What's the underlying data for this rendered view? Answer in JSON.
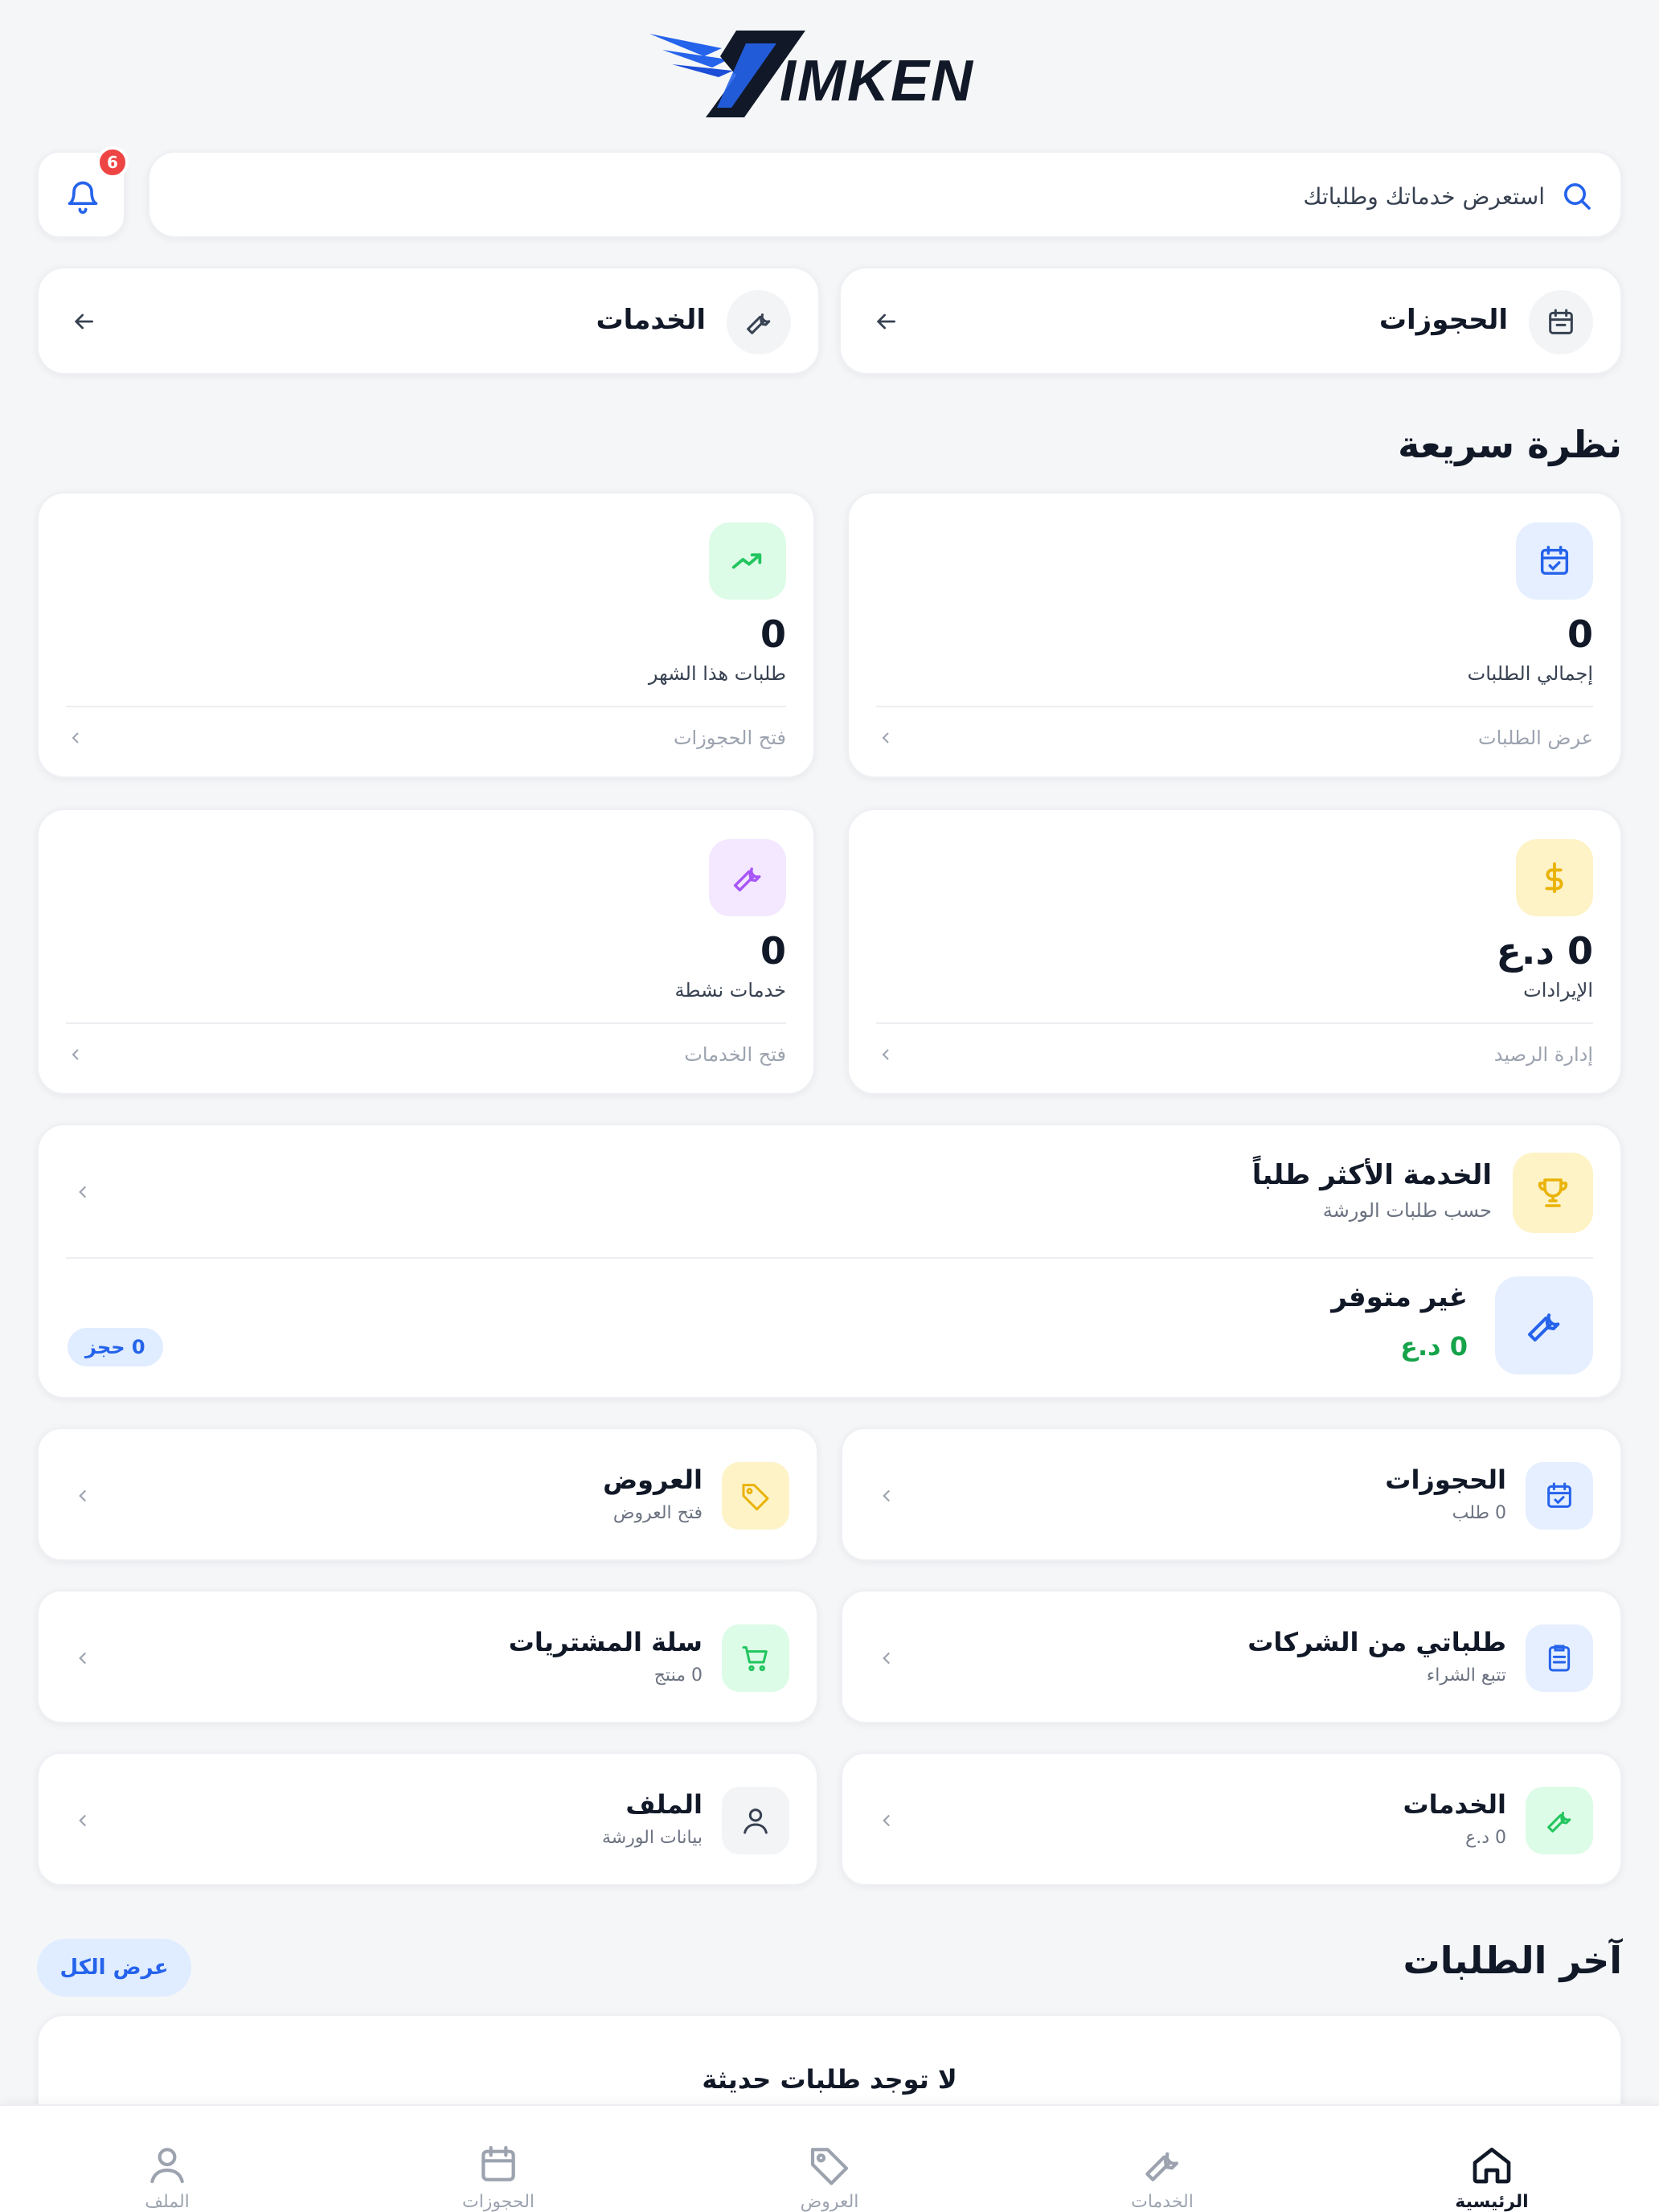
{
  "brand": {
    "logo_text": "IMKEN"
  },
  "header": {
    "search_placeholder": "استعرض خدماتك وطلباتك",
    "notification_count": "6"
  },
  "shortcuts": [
    {
      "label": "الحجوزات",
      "icon": "calendar-icon"
    },
    {
      "label": "الخدمات",
      "icon": "wrench-icon"
    }
  ],
  "overview": {
    "title": "نظرة سريعة",
    "stats": [
      {
        "value": "0",
        "label": "إجمالي الطلبات",
        "link": "عرض الطلبات",
        "icon": "calendar-check-icon",
        "color": "#2563eb"
      },
      {
        "value": "0",
        "label": "طلبات هذا الشهر",
        "link": "فتح الحجوزات",
        "icon": "trending-up-icon",
        "color": "#22c55e"
      },
      {
        "value": "0 د.ع",
        "label": "الإيرادات",
        "link": "إدارة الرصيد",
        "icon": "dollar-icon",
        "color": "#eab308"
      },
      {
        "value": "0",
        "label": "خدمات نشطة",
        "link": "فتح الخدمات",
        "icon": "wrench-icon",
        "color": "#a855f7"
      }
    ]
  },
  "top_service": {
    "title": "الخدمة الأكثر طلباً",
    "subtitle": "حسب طلبات الورشة",
    "name": "غير متوفر",
    "price": "0 د.ع",
    "badge": "0 حجز"
  },
  "quick_links": [
    {
      "title": "الحجوزات",
      "subtitle": "0 طلب",
      "icon": "calendar-check-icon"
    },
    {
      "title": "العروض",
      "subtitle": "فتح العروض",
      "icon": "tag-icon"
    },
    {
      "title": "طلباتي من الشركات",
      "subtitle": "تتبع الشراء",
      "icon": "clipboard-icon"
    },
    {
      "title": "سلة المشتريات",
      "subtitle": "0 منتج",
      "icon": "cart-icon"
    },
    {
      "title": "الخدمات",
      "subtitle": "0 د.ع",
      "icon": "wrench-icon"
    },
    {
      "title": "الملف",
      "subtitle": "بيانات الورشة",
      "icon": "user-icon"
    }
  ],
  "recent": {
    "title": "آخر الطلبات",
    "view_all": "عرض الكل",
    "empty": "لا توجد طلبات حديثة"
  },
  "bottom_nav": [
    {
      "label": "الرئيسية",
      "icon": "home-icon",
      "active": true
    },
    {
      "label": "الخدمات",
      "icon": "wrench-icon",
      "active": false
    },
    {
      "label": "العروض",
      "icon": "tag-icon",
      "active": false
    },
    {
      "label": "الحجوزات",
      "icon": "calendar-icon",
      "active": false
    },
    {
      "label": "الملف",
      "icon": "user-icon",
      "active": false
    }
  ]
}
